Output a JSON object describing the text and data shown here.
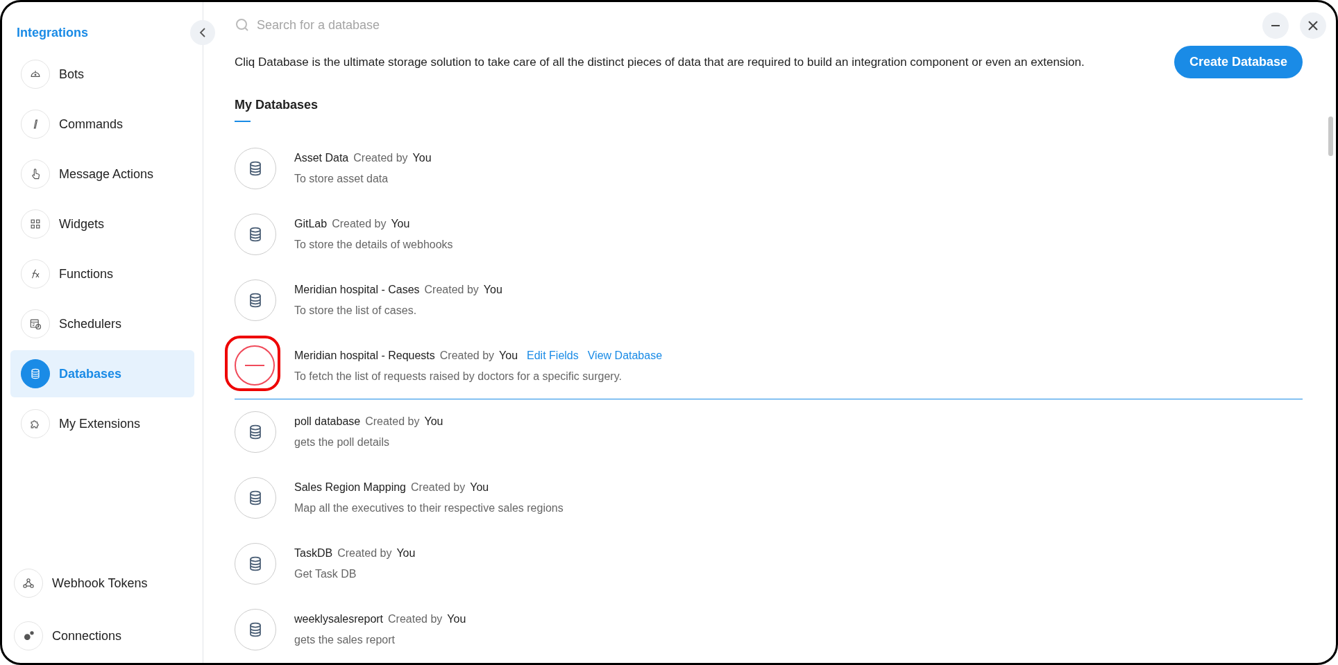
{
  "sidebar": {
    "title": "Integrations",
    "items": [
      {
        "label": "Bots",
        "selected": false
      },
      {
        "label": "Commands",
        "selected": false
      },
      {
        "label": "Message Actions",
        "selected": false
      },
      {
        "label": "Widgets",
        "selected": false
      },
      {
        "label": "Functions",
        "selected": false
      },
      {
        "label": "Schedulers",
        "selected": false
      },
      {
        "label": "Databases",
        "selected": true
      },
      {
        "label": "My Extensions",
        "selected": false
      }
    ],
    "bottom_items": [
      {
        "label": "Webhook Tokens"
      },
      {
        "label": "Connections"
      }
    ]
  },
  "search": {
    "placeholder": "Search for a database"
  },
  "description": "Cliq Database is the ultimate storage solution to take care of all the distinct pieces of data that are required to build an integration component or even an extension.",
  "create_button": "Create Database",
  "section_title": "My Databases",
  "databases": [
    {
      "name": "Asset Data",
      "created_label": "Created by",
      "owner": "You",
      "description": "To store asset data",
      "hovered": false
    },
    {
      "name": "GitLab",
      "created_label": "Created by",
      "owner": "You",
      "description": "To store the details of webhooks",
      "hovered": false
    },
    {
      "name": "Meridian hospital - Cases",
      "created_label": "Created by",
      "owner": "You",
      "description": "To store the list of cases.",
      "hovered": false
    },
    {
      "name": "Meridian hospital - Requests",
      "created_label": "Created by",
      "owner": "You",
      "description": "To fetch the list of requests raised by doctors for a specific surgery.",
      "hovered": true,
      "actions": [
        "Edit Fields",
        "View Database"
      ]
    },
    {
      "name": "poll database",
      "created_label": "Created by",
      "owner": "You",
      "description": "gets the poll details",
      "hovered": false
    },
    {
      "name": "Sales Region Mapping",
      "created_label": "Created by",
      "owner": "You",
      "description": "Map all the executives to their respective sales regions",
      "hovered": false
    },
    {
      "name": "TaskDB",
      "created_label": "Created by",
      "owner": "You",
      "description": "Get Task DB",
      "hovered": false
    },
    {
      "name": "weeklysalesreport",
      "created_label": "Created by",
      "owner": "You",
      "description": "gets the sales report",
      "hovered": false
    }
  ]
}
